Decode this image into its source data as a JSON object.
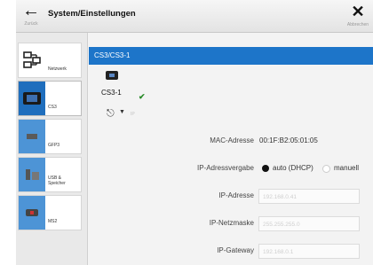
{
  "header": {
    "back_caption": "Zurück",
    "title": "System/Einstellungen",
    "close_caption": "Abbrechen"
  },
  "sidebar": {
    "items": [
      {
        "label": "Netzwerk",
        "icon": "network-icon"
      },
      {
        "label": "CS3",
        "icon": "cs3-device-icon"
      },
      {
        "label": "GFP3",
        "icon": "gfp3-module-icon"
      },
      {
        "label": "USB &\nSpeicher",
        "icon": "usb-storage-icon"
      },
      {
        "label": "MS2",
        "icon": "ms2-controller-icon"
      }
    ]
  },
  "main": {
    "device_header": "CS3/CS3-1",
    "device_name": "CS3-1",
    "net_ip_caption": "IP",
    "mac": {
      "label": "MAC-Adresse",
      "value": "00:1F:B2:05:01:05"
    },
    "ip_mode": {
      "label": "IP-Adressvergabe",
      "options": [
        {
          "label": "auto (DHCP)",
          "selected": true
        },
        {
          "label": "manuell",
          "selected": false
        }
      ]
    },
    "ip_address": {
      "label": "IP-Adresse",
      "value": "192.168.0.41"
    },
    "netmask": {
      "label": "IP-Netzmaske",
      "value": "255.255.255.0"
    },
    "gateway": {
      "label": "IP-Gateway",
      "value": "192.168.0.1"
    }
  },
  "colors": {
    "accent": "#1d75c9",
    "status_ok": "#2a8b2a"
  }
}
